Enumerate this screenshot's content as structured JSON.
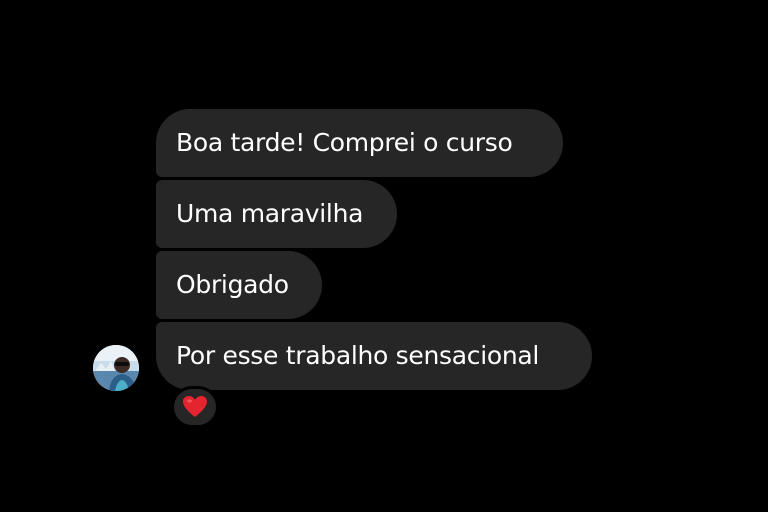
{
  "messages": [
    {
      "text": "Boa tarde! Comprei o curso"
    },
    {
      "text": "Uma maravilha"
    },
    {
      "text": "Obrigado"
    },
    {
      "text": "Por esse trabalho sensacional"
    }
  ],
  "sender": {
    "avatar_icon": "profile-photo"
  },
  "reaction": {
    "icon": "red-heart-icon",
    "color": "#e4252f"
  },
  "colors": {
    "background": "#000000",
    "bubble": "#262626",
    "text": "#ffffff"
  }
}
